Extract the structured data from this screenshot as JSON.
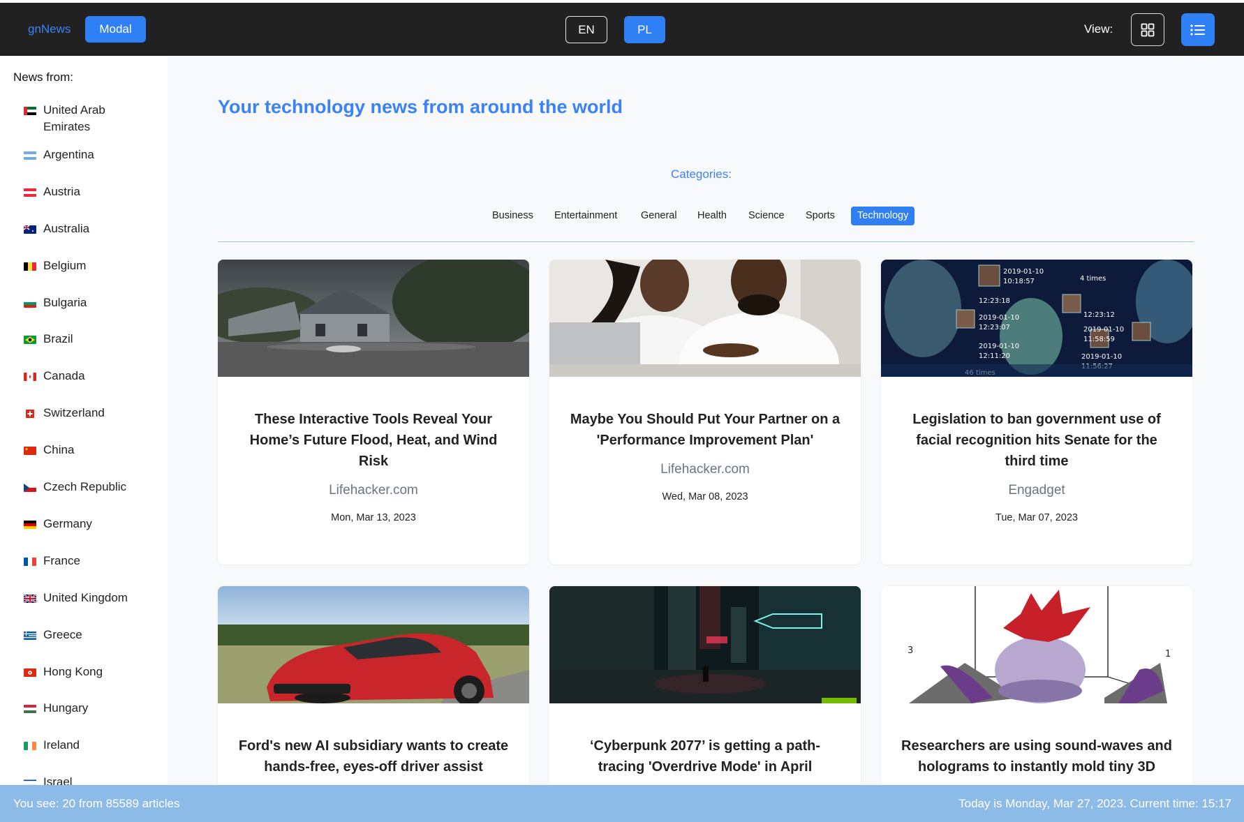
{
  "navbar": {
    "brand": "gnNews",
    "modal_label": "Modal",
    "lang_en": "EN",
    "lang_pl": "PL",
    "view_label": "View:"
  },
  "sidebar": {
    "title": "News from:",
    "countries": [
      {
        "name": "United Arab Emirates",
        "line1": "United Arab",
        "line2": "Emirates"
      },
      {
        "name": "Argentina"
      },
      {
        "name": "Austria"
      },
      {
        "name": "Australia"
      },
      {
        "name": "Belgium"
      },
      {
        "name": "Bulgaria"
      },
      {
        "name": "Brazil"
      },
      {
        "name": "Canada"
      },
      {
        "name": "Switzerland"
      },
      {
        "name": "China"
      },
      {
        "name": "Czech Republic"
      },
      {
        "name": "Germany"
      },
      {
        "name": "France"
      },
      {
        "name": "United Kingdom"
      },
      {
        "name": "Greece"
      },
      {
        "name": "Hong Kong"
      },
      {
        "name": "Hungary"
      },
      {
        "name": "Ireland"
      },
      {
        "name": "Israel"
      }
    ]
  },
  "main": {
    "headline": "Your technology news from around the world",
    "categories_label": "Categories:",
    "categories": [
      "Business",
      "Entertainment",
      "General",
      "Health",
      "Science",
      "Sports",
      "Technology"
    ],
    "active_category": "Technology",
    "cards": [
      {
        "title": "These Interactive Tools Reveal Your Home’s Future Flood, Heat, and Wind Risk",
        "source": "Lifehacker.com",
        "date": "Mon, Mar 13, 2023"
      },
      {
        "title": "Maybe You Should Put Your Partner on a 'Performance Improvement Plan'",
        "source": "Lifehacker.com",
        "date": "Wed, Mar 08, 2023"
      },
      {
        "title": "Legislation to ban government use of facial recognition hits Senate for the third time",
        "source": "Engadget",
        "date": "Tue, Mar 07, 2023"
      },
      {
        "title": "Ford's new AI subsidiary wants to create hands-free, eyes-off driver assist"
      },
      {
        "title": "‘Cyberpunk 2077’ is getting a path-tracing 'Overdrive Mode' in April"
      },
      {
        "title": "Researchers are using sound-waves and holograms to instantly mold tiny 3D"
      }
    ]
  },
  "footer": {
    "left": "You see: 20 from 85589 articles",
    "right": "Today is Monday, Mar 27, 2023. Current time: 15:17"
  },
  "colors": {
    "accent": "#2f7ff5",
    "brand_text": "#3b82f6",
    "navbar_bg": "#212121",
    "footer_bg": "#8cbbe8"
  },
  "icons": {
    "grid_view": "grid-icon",
    "list_view": "list-icon"
  }
}
